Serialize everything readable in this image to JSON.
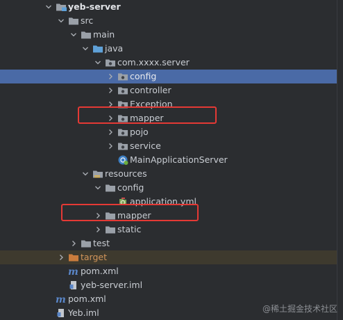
{
  "colors": {
    "background": "#2b2d30",
    "selected_row": "#4a6aa6",
    "excluded_row": "#3e3a2e",
    "folder_gray": "#9aa0a8",
    "folder_blue": "#5fa1d8",
    "folder_orange": "#c97c3d",
    "annotation_red": "#e53935"
  },
  "tree": {
    "nodes": [
      {
        "label": "yeb-server",
        "icon": "module-folder-icon",
        "arrow": "down",
        "bold": true
      },
      {
        "label": "src",
        "icon": "folder-icon",
        "arrow": "down"
      },
      {
        "label": "main",
        "icon": "folder-icon",
        "arrow": "down"
      },
      {
        "label": "java",
        "icon": "source-folder-icon",
        "arrow": "down"
      },
      {
        "label": "com.xxxx.server",
        "icon": "package-icon",
        "arrow": "down"
      },
      {
        "label": "config",
        "icon": "package-icon",
        "arrow": "right",
        "selected": true
      },
      {
        "label": "controller",
        "icon": "package-icon",
        "arrow": "right"
      },
      {
        "label": "Exception",
        "icon": "package-icon",
        "arrow": "right"
      },
      {
        "label": "mapper",
        "icon": "package-icon",
        "arrow": "right",
        "annotated": true
      },
      {
        "label": "pojo",
        "icon": "package-icon",
        "arrow": "right"
      },
      {
        "label": "service",
        "icon": "package-icon",
        "arrow": "right"
      },
      {
        "label": "MainApplicationServer",
        "icon": "spring-boot-class-icon",
        "arrow": "none"
      },
      {
        "label": "resources",
        "icon": "resources-folder-icon",
        "arrow": "down"
      },
      {
        "label": "config",
        "icon": "folder-icon",
        "arrow": "down"
      },
      {
        "label": "application.yml",
        "icon": "spring-config-file-icon",
        "arrow": "none"
      },
      {
        "label": "mapper",
        "icon": "folder-icon",
        "arrow": "right",
        "annotated": true
      },
      {
        "label": "static",
        "icon": "folder-icon",
        "arrow": "right"
      },
      {
        "label": "test",
        "icon": "folder-icon",
        "arrow": "right"
      },
      {
        "label": "target",
        "icon": "excluded-folder-icon",
        "arrow": "right",
        "excluded": true
      },
      {
        "label": "pom.xml",
        "icon": "maven-icon",
        "arrow": "none"
      },
      {
        "label": "yeb-server.iml",
        "icon": "iml-file-icon",
        "arrow": "none"
      },
      {
        "label": "pom.xml",
        "icon": "maven-icon",
        "arrow": "none"
      },
      {
        "label": "Yeb.iml",
        "icon": "iml-file-icon",
        "arrow": "none"
      }
    ]
  },
  "watermark": "@稀土掘金技术社区"
}
